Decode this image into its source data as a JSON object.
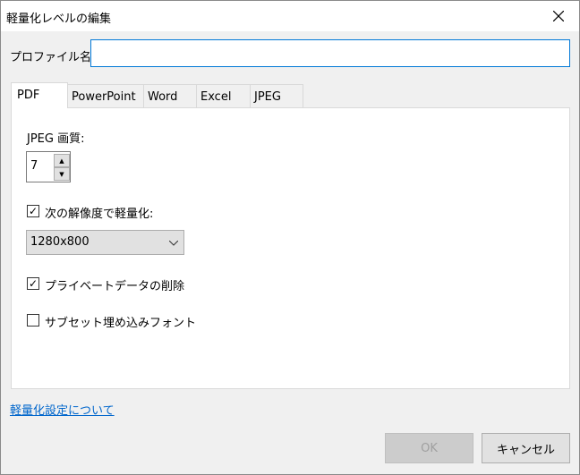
{
  "window": {
    "title": "軽量化レベルの編集"
  },
  "profile": {
    "label": "プロファイル名:",
    "value": ""
  },
  "tabs": [
    {
      "label": "PDF",
      "selected": true
    },
    {
      "label": "PowerPoint"
    },
    {
      "label": "Word"
    },
    {
      "label": "Excel"
    },
    {
      "label": "JPEG"
    }
  ],
  "pdf": {
    "jpeg_quality_label": "JPEG 画質:",
    "jpeg_quality_value": "7",
    "resolution_checkbox": {
      "label": "次の解像度で軽量化:",
      "checked": true
    },
    "resolution_select": "1280x800",
    "private_data_checkbox": {
      "label": "プライベートデータの削除",
      "checked": true
    },
    "subset_font_checkbox": {
      "label": "サブセット埋め込みフォント",
      "checked": false
    }
  },
  "link": "軽量化設定について",
  "buttons": {
    "ok": "OK",
    "cancel": "キャンセル"
  },
  "colors": {
    "accent": "#0078d7",
    "link": "#0066cc",
    "disabled_text": "#a0a0a0"
  }
}
